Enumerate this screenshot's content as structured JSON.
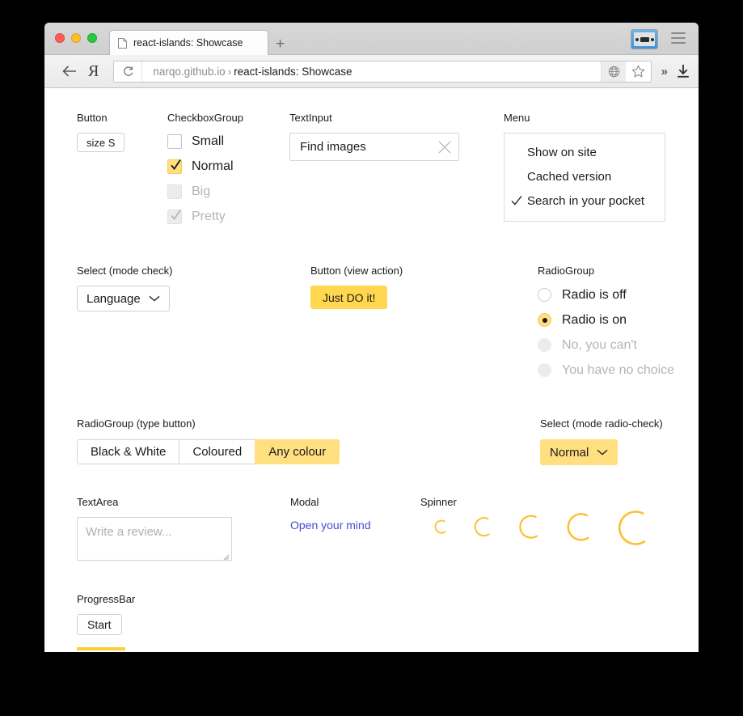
{
  "browser": {
    "tab": {
      "title": "react-islands: Showcase",
      "icon": "document-icon"
    },
    "new_tab_label": "+",
    "url": {
      "domain": "narqo.github.io",
      "separator": "›",
      "title": "react-islands: Showcase"
    },
    "toolbar_icons": {
      "back": "back-arrow-icon",
      "yandex": "Я",
      "reload": "reload-icon",
      "globe": "globe-icon",
      "bookmark": "star-icon",
      "more": "»",
      "download": "download-icon",
      "extension": "cassette-icon",
      "menu": "hamburger-icon"
    }
  },
  "sections": {
    "button": {
      "label": "Button",
      "button_label": "size S"
    },
    "checkbox_group": {
      "label": "CheckboxGroup",
      "items": [
        {
          "label": "Small",
          "checked": false,
          "disabled": false
        },
        {
          "label": "Normal",
          "checked": true,
          "disabled": false
        },
        {
          "label": "Big",
          "checked": false,
          "disabled": true
        },
        {
          "label": "Pretty",
          "checked": true,
          "disabled": true
        }
      ]
    },
    "text_input": {
      "label": "TextInput",
      "value": "Find images",
      "placeholder": "Find images",
      "clear_icon": "close-icon"
    },
    "menu": {
      "label": "Menu",
      "items": [
        {
          "label": "Show on site",
          "checked": false
        },
        {
          "label": "Cached version",
          "checked": false
        },
        {
          "label": "Search in your pocket",
          "checked": true
        }
      ]
    },
    "select_check": {
      "label": "Select (mode check)",
      "value": "Language"
    },
    "button_action": {
      "label": "Button (view action)",
      "button_label": "Just DO it!"
    },
    "radio_group": {
      "label": "RadioGroup",
      "items": [
        {
          "label": "Radio is off",
          "checked": false,
          "disabled": false
        },
        {
          "label": "Radio is on",
          "checked": true,
          "disabled": false
        },
        {
          "label": "No, you can't",
          "checked": false,
          "disabled": true
        },
        {
          "label": "You have no choice",
          "checked": false,
          "disabled": true
        }
      ]
    },
    "radio_group_button": {
      "label": "RadioGroup (type button)",
      "items": [
        {
          "label": "Black & White",
          "active": false
        },
        {
          "label": "Coloured",
          "active": false
        },
        {
          "label": "Any colour",
          "active": true
        }
      ]
    },
    "select_radio_check": {
      "label": "Select (mode radio-check)",
      "value": "Normal"
    },
    "textarea": {
      "label": "TextArea",
      "value": "",
      "placeholder": "Write a review..."
    },
    "modal": {
      "label": "Modal",
      "link_label": "Open your mind"
    },
    "spinner": {
      "label": "Spinner",
      "sizes": [
        8,
        11,
        14,
        17,
        21
      ]
    },
    "progress_bar": {
      "label": "ProgressBar",
      "button_label": "Start",
      "progress_percent": 48
    }
  },
  "colors": {
    "accent_yellow": "#ffd84f",
    "accent_soft": "#ffdf80",
    "spinner": "#fbc02d",
    "progress": "#fbcf35",
    "link": "#4a49d6",
    "background": "#000000"
  }
}
